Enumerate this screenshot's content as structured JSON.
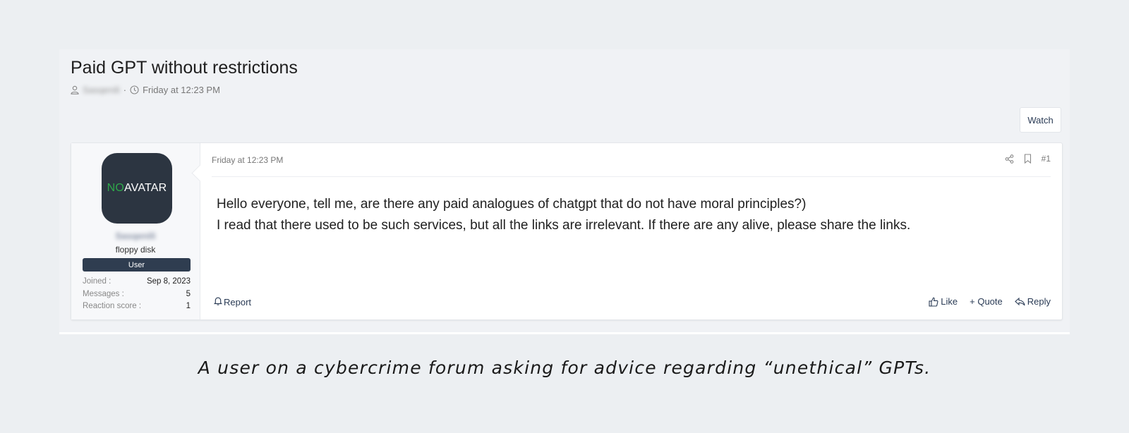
{
  "thread": {
    "title": "Paid GPT without restrictions",
    "author": "Sasqenili",
    "separator": "·",
    "date": "Friday at 12:23 PM",
    "watch_label": "Watch"
  },
  "post": {
    "date": "Friday at 12:23 PM",
    "number": "#1",
    "body_lines": [
      "Hello everyone, tell me, are there any paid analogues of chatgpt that do not have moral principles?)",
      "I read that there used to be such services, but all the links are irrelevant. If there are any alive, please share the links."
    ],
    "report_label": "Report",
    "like_label": "Like",
    "quote_label": "+ Quote",
    "reply_label": "Reply"
  },
  "user": {
    "avatar_no": "NO",
    "avatar_avatar": "AVATAR",
    "username": "Sasqenili",
    "title": "floppy disk",
    "banner": "User",
    "stats": [
      {
        "label": "Joined :",
        "value": "Sep 8, 2023"
      },
      {
        "label": "Messages :",
        "value": "5"
      },
      {
        "label": "Reaction score :",
        "value": "1"
      }
    ]
  },
  "caption": "A user on a cybercrime forum asking for advice regarding “unethical” GPTs.",
  "icons": {
    "author": "user-icon",
    "date": "clock-icon",
    "share": "share-icon",
    "bookmark": "bookmark-icon",
    "report": "bell-icon",
    "like": "thumbs-up-icon",
    "reply": "reply-icon"
  },
  "colors": {
    "background": "#eceff2",
    "banner": "#2f3d50",
    "avatar_bg": "#2c3541",
    "avatar_no": "#2ea84a",
    "link": "#2a3b55"
  }
}
